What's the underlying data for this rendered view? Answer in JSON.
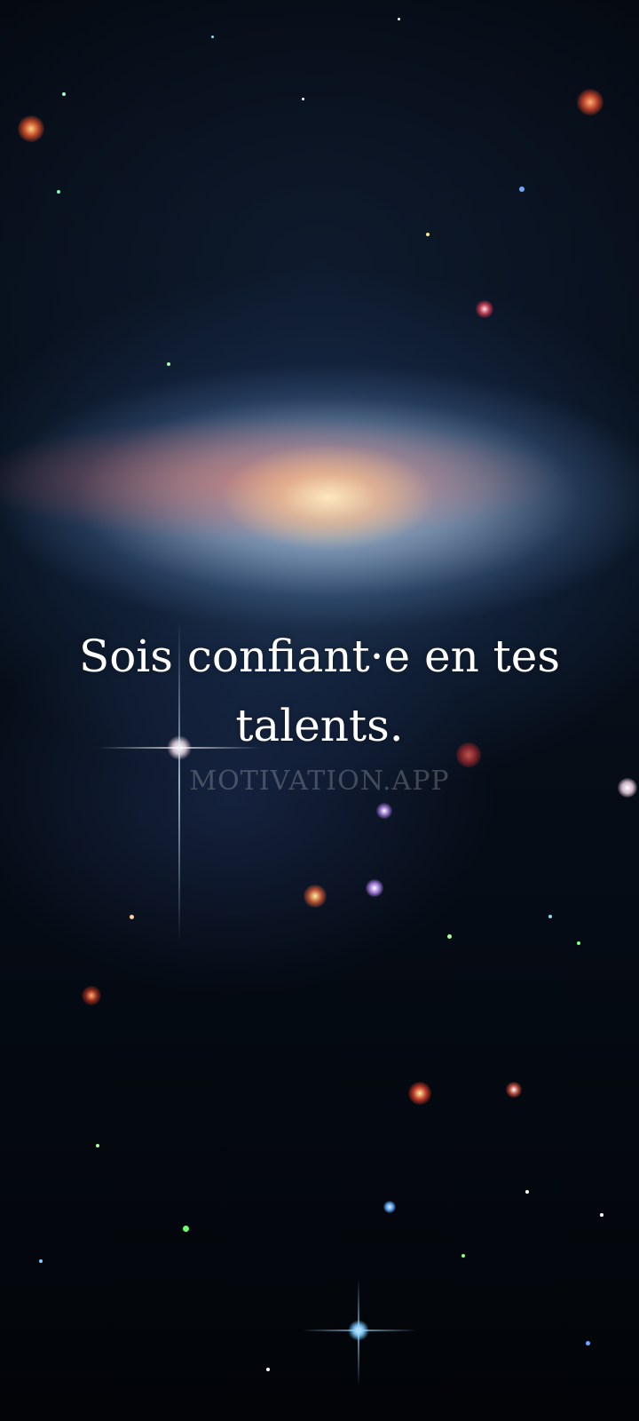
{
  "background": {
    "image": "spiral galaxy nebula with stars",
    "colors": {
      "space": "#050a12",
      "galaxy_core": "#ffe6bf",
      "dust_lane": "#e66e5a",
      "halo": "#aac3e1"
    }
  },
  "quote": {
    "text": "Sois confiant·e en tes talents."
  },
  "watermark": {
    "text": "MOTIVATION.APP"
  }
}
